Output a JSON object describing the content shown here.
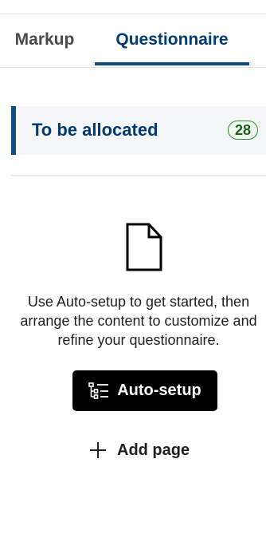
{
  "tabs": [
    {
      "label": "Markup",
      "selected": false
    },
    {
      "label": "Questionnaire",
      "selected": true
    }
  ],
  "allocation": {
    "title": "To be allocated",
    "count": "28"
  },
  "empty_state": {
    "icon": "document-icon",
    "message": "Use Auto-setup to get started, then arrange the content to customize and refine your questionnaire."
  },
  "actions": {
    "auto_setup_label": "Auto-setup",
    "auto_setup_icon": "tree-list-icon",
    "add_page_label": "Add page",
    "add_page_icon": "plus-icon"
  },
  "colors": {
    "accent": "#0f4c81",
    "count_badge_border": "#2e8b2e",
    "button_bg": "#000000"
  }
}
